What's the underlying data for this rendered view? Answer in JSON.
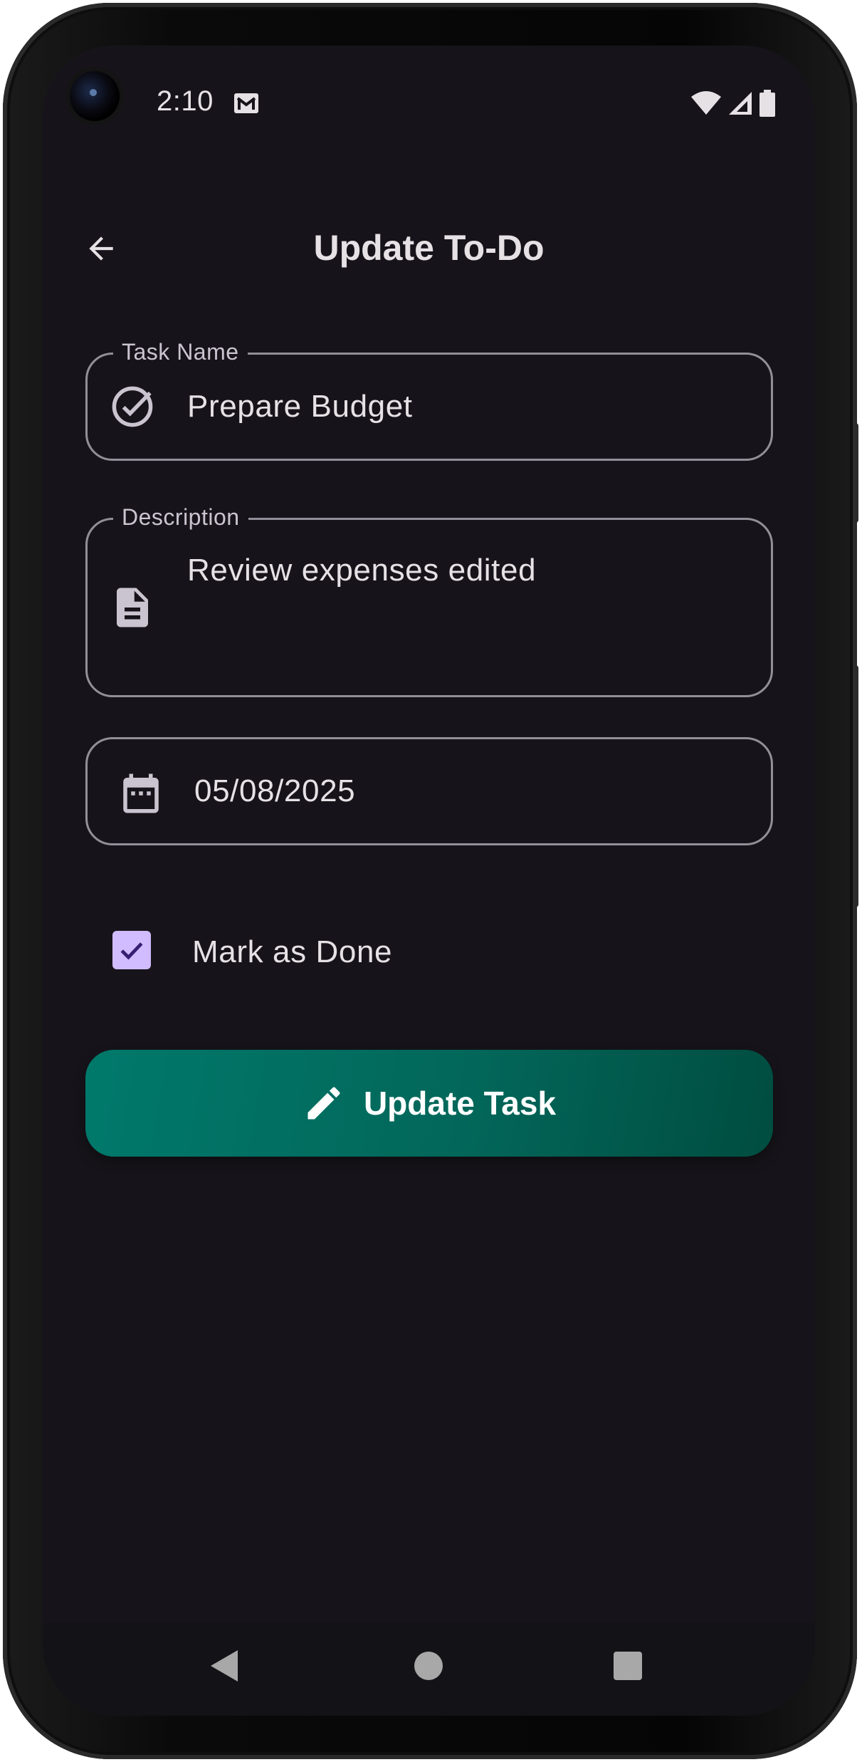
{
  "status_bar": {
    "time": "2:10",
    "notification_icon": "mail-icon",
    "icons": [
      "wifi-icon",
      "cellular-signal-icon",
      "battery-icon"
    ]
  },
  "app_bar": {
    "back_icon": "arrow-back-icon",
    "title": "Update To-Do"
  },
  "form": {
    "task_name": {
      "label": "Task Name",
      "value": "Prepare Budget",
      "icon": "check-circle-icon"
    },
    "description": {
      "label": "Description",
      "value": "Review expenses edited",
      "icon": "document-icon"
    },
    "date": {
      "value": "05/08/2025",
      "icon": "calendar-icon"
    },
    "done": {
      "label": "Mark as Done",
      "checked": true
    },
    "submit": {
      "label": "Update Task",
      "icon": "edit-pencil-icon"
    }
  },
  "nav_bar": {
    "icons": [
      "nav-back-icon",
      "nav-home-icon",
      "nav-recents-icon"
    ]
  },
  "colors": {
    "background": "#16141a",
    "text": "#e6e1e5",
    "outline": "#938f99",
    "checkbox": "#d0bcff",
    "button_start": "#00796b",
    "button_end": "#004d40"
  }
}
